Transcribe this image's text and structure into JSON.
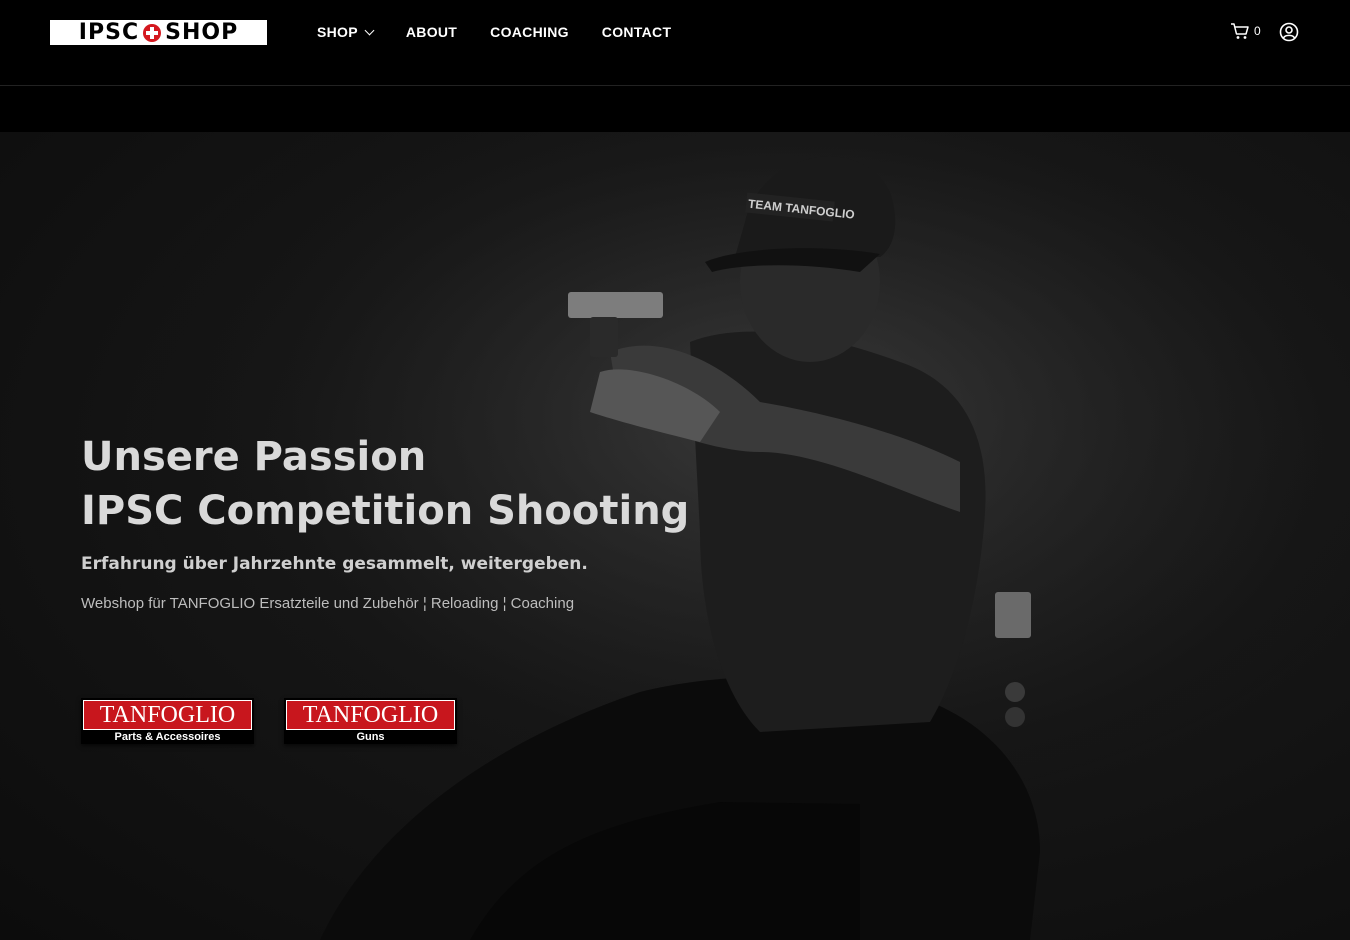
{
  "header": {
    "logo": {
      "left": "IPSC",
      "right": "SHOP"
    },
    "nav": [
      {
        "label": "SHOP",
        "has_dropdown": true
      },
      {
        "label": "ABOUT"
      },
      {
        "label": "COACHING"
      },
      {
        "label": "CONTACT"
      }
    ],
    "cart": {
      "count": "0",
      "icon": "shopping-cart-icon"
    },
    "account": {
      "icon": "user-icon"
    }
  },
  "hero": {
    "headline_line1": "Unsere Passion",
    "headline_line2": "IPSC Competition Shooting",
    "subheadline": "Erfahrung über Jahrzehnte gesammelt, weitergeben.",
    "tagline": "Webshop für TANFOGLIO Ersatzteile und Zubehör  ¦  Reloading  ¦  Coaching",
    "image_cap_text": "TEAM TANFOGLIO",
    "brands": [
      {
        "name": "TANFOGLIO",
        "caption": "Parts & Accessoires"
      },
      {
        "name": "TANFOGLIO",
        "caption": "Guns"
      }
    ]
  },
  "colors": {
    "background": "#000000",
    "brand_red": "#c8161d",
    "headline": "#d9d9d9"
  }
}
